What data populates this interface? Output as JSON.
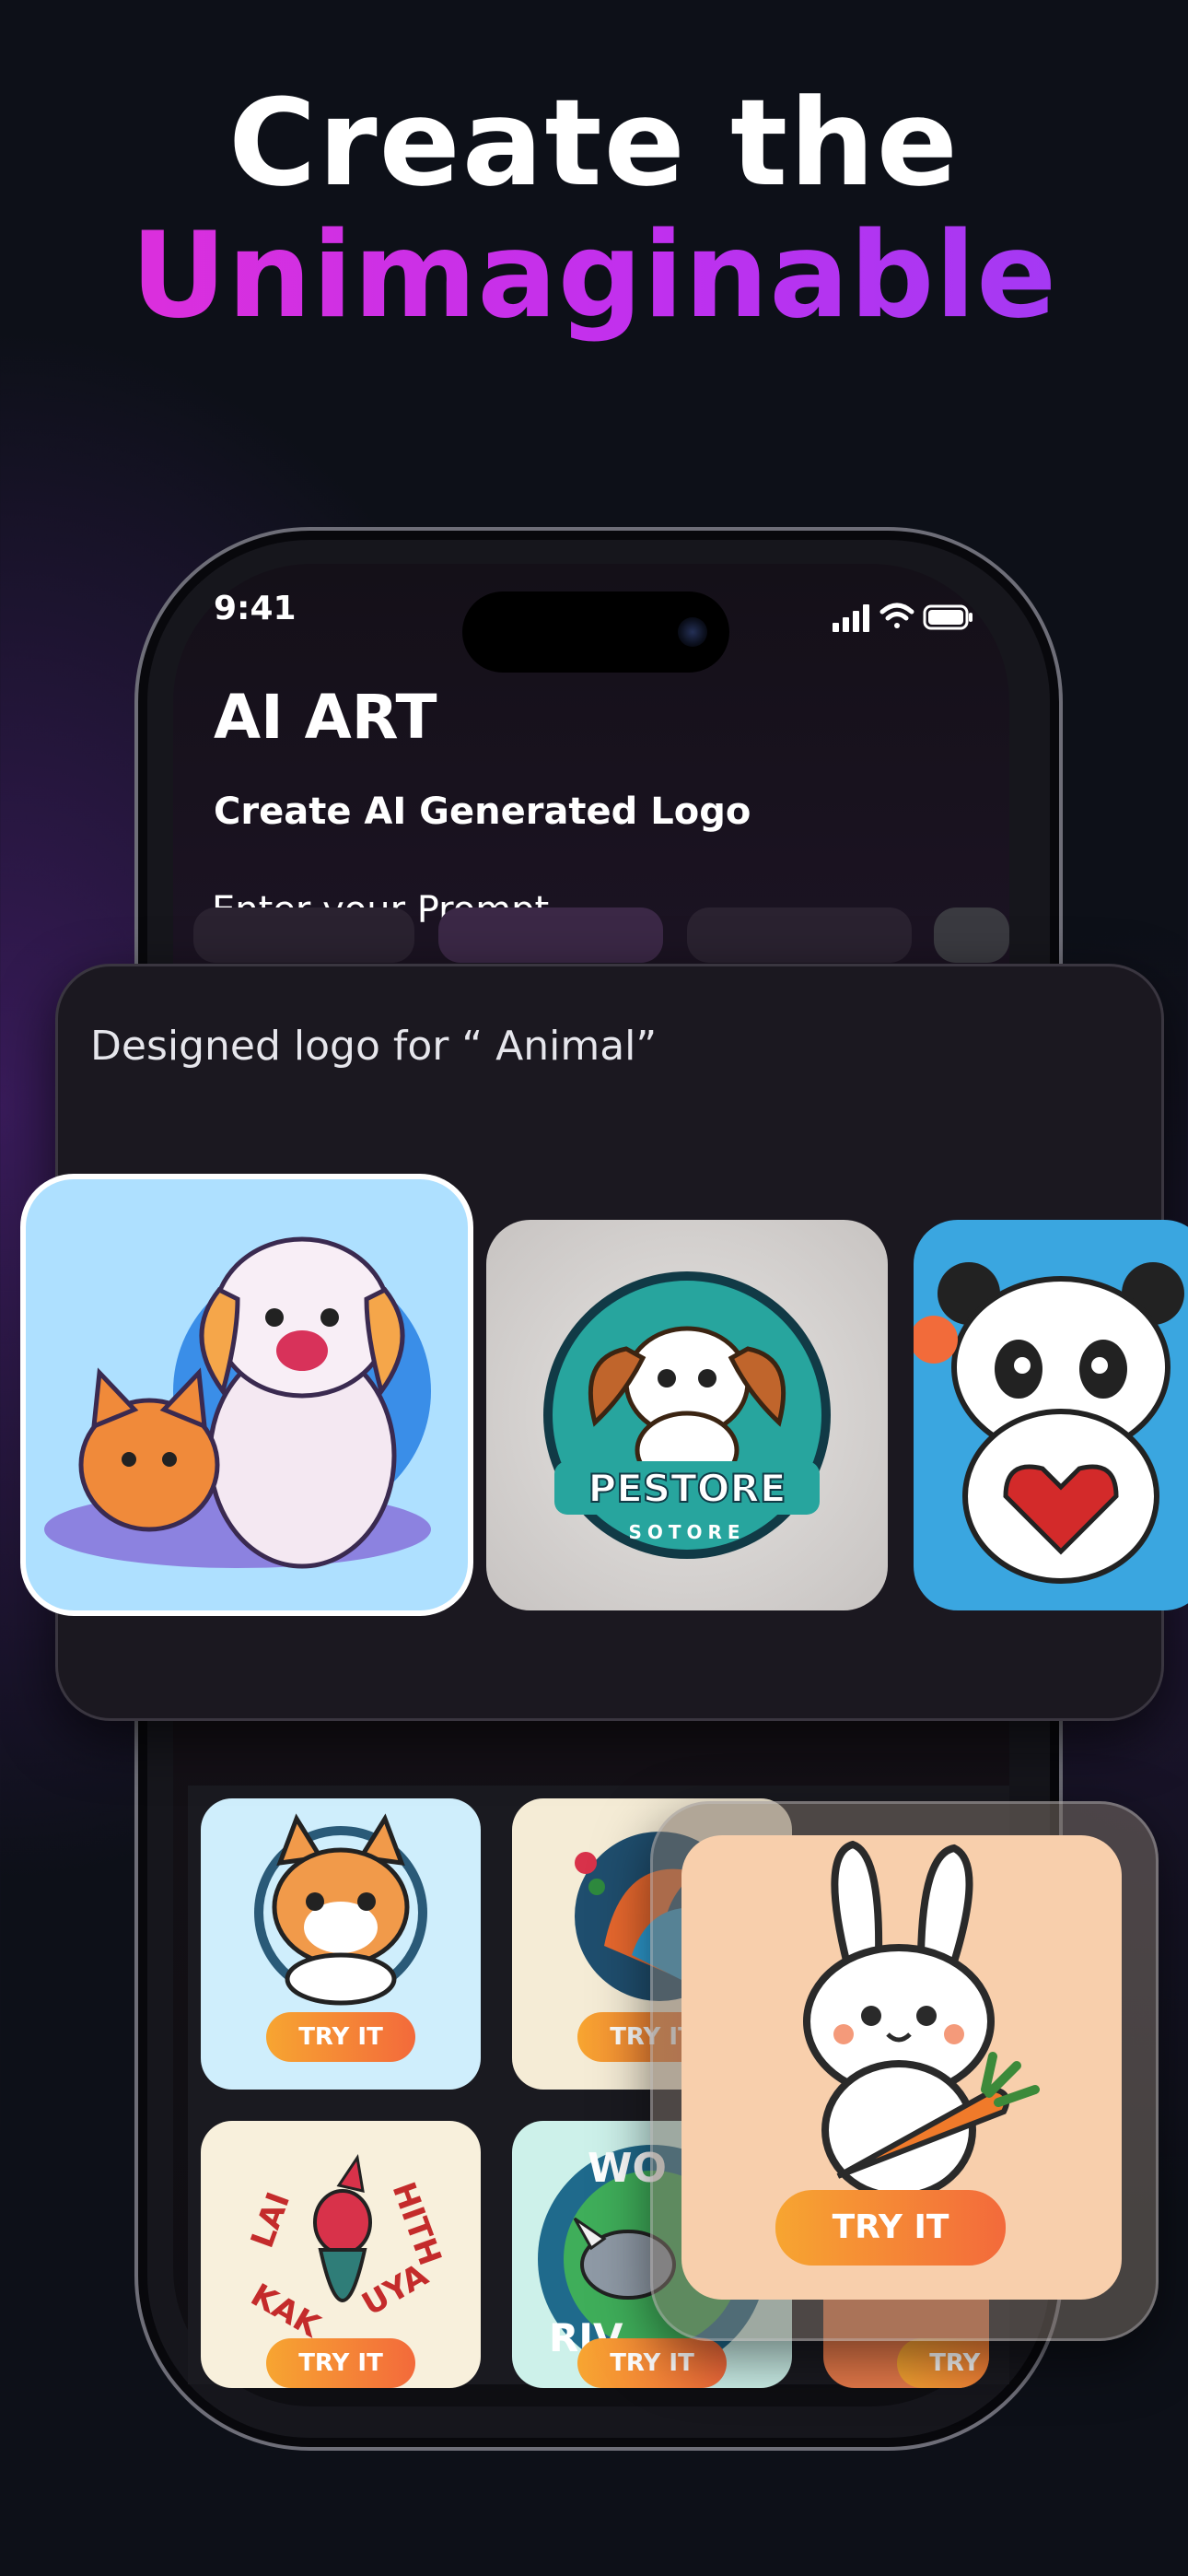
{
  "headline": {
    "line1": "Create the",
    "line2": "Unimaginable"
  },
  "status_bar": {
    "time": "9:41"
  },
  "app": {
    "title": "AI ART",
    "subtitle": "Create AI Generated Logo",
    "prompt_label": "Enter your Prompt"
  },
  "designed": {
    "label": "Designed logo for  “ Animal”",
    "logos": [
      "dog-and-cat-logo",
      "pestore-puppy-logo",
      "panda-heart-logo"
    ],
    "badge_text": "PESTORE",
    "badge_subtext": "SOTORE"
  },
  "grid": {
    "try_label": "TRY IT",
    "items": [
      "cat-logo",
      "parrot-logo",
      "lai-hith-parrot-logo",
      "rhino-world-logo",
      "partial-logo"
    ]
  },
  "featured": {
    "try_label": "TRY IT",
    "logo": "bunny-carrot-logo"
  },
  "colors": {
    "accent_magenta": "#e22fd8",
    "accent_purple": "#9b3cf5",
    "try_orange": "#f7a531",
    "try_red": "#f36a3b"
  }
}
